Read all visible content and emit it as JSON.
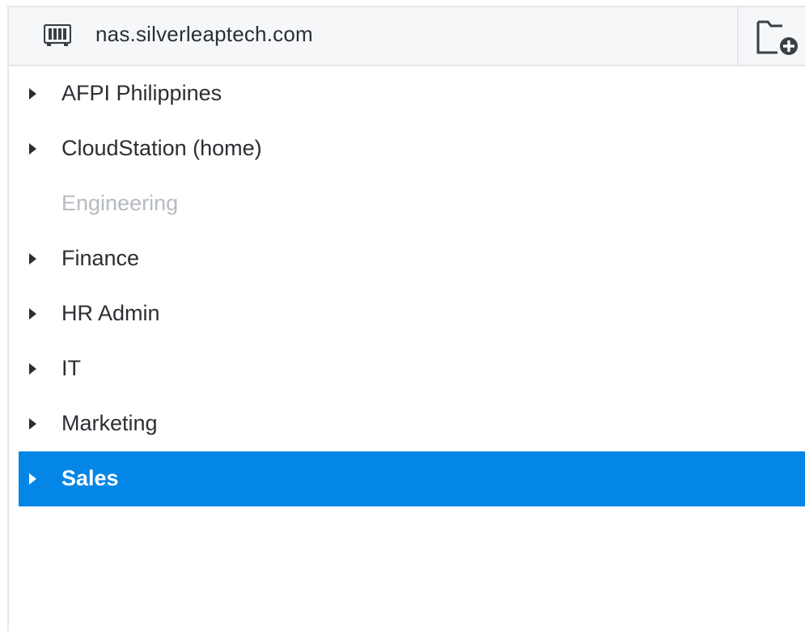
{
  "header": {
    "server_name": "nas.silverleaptech.com",
    "server_icon": "nas-server-icon",
    "new_folder_icon": "new-folder-icon"
  },
  "tree": {
    "items": [
      {
        "label": "AFPI Philippines",
        "expandable": true,
        "disabled": false,
        "selected": false
      },
      {
        "label": "CloudStation (home)",
        "expandable": true,
        "disabled": false,
        "selected": false
      },
      {
        "label": "Engineering",
        "expandable": false,
        "disabled": true,
        "selected": false
      },
      {
        "label": "Finance",
        "expandable": true,
        "disabled": false,
        "selected": false
      },
      {
        "label": "HR Admin",
        "expandable": true,
        "disabled": false,
        "selected": false
      },
      {
        "label": "IT",
        "expandable": true,
        "disabled": false,
        "selected": false
      },
      {
        "label": "Marketing",
        "expandable": true,
        "disabled": false,
        "selected": false
      },
      {
        "label": "Sales",
        "expandable": true,
        "disabled": false,
        "selected": true
      }
    ]
  },
  "colors": {
    "selection": "#0386e6",
    "text": "#2b2f33",
    "disabled_text": "#b6bbc0",
    "header_bg": "#f5f7f9",
    "border": "#e3e6ea"
  }
}
